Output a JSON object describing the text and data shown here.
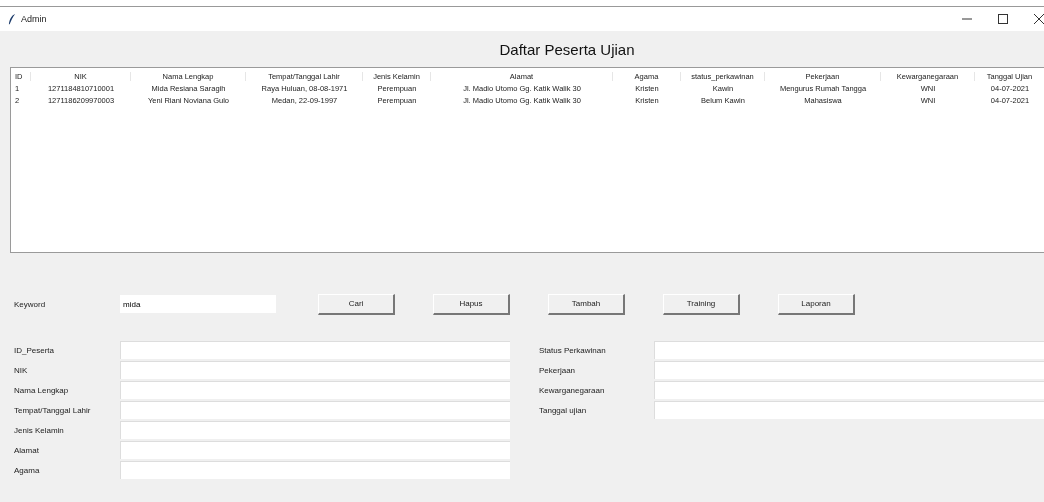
{
  "window": {
    "title": "Admin"
  },
  "heading": "Daftar Peserta Ujian",
  "table": {
    "columns": [
      "ID",
      "NIK",
      "Nama Lengkap",
      "Tempat/Tanggal Lahir",
      "Jenis Kelamin",
      "Alamat",
      "Agama",
      "status_perkawinan",
      "Pekerjaan",
      "Kewarganegaraan",
      "Tanggal Ujian"
    ],
    "rows": [
      [
        "1",
        "1271184810710001",
        "Mida Resiana Saragih",
        "Raya Huluan, 08-08-1971",
        "Perempuan",
        "Jl. Madio Utomo Gg. Katik Walik 30",
        "Kristen",
        "Kawin",
        "Mengurus Rumah Tangga",
        "WNI",
        "04-07-2021"
      ],
      [
        "2",
        "1271186209970003",
        "Yeni Riani Noviana Gulo",
        "Medan, 22-09-1997",
        "Perempuan",
        "Jl. Madio Utomo Gg. Katik Walik 30",
        "Kristen",
        "Belum Kawin",
        "Mahasiswa",
        "WNI",
        "04-07-2021"
      ]
    ]
  },
  "search": {
    "label": "Keyword",
    "value": "mida"
  },
  "buttons": [
    "Cari",
    "Hapus",
    "Tambah",
    "Training",
    "Laporan"
  ],
  "form_left": [
    "ID_Peserta",
    "NIK",
    "Nama Lengkap",
    "Tempat/Tanggal Lahir",
    "Jenis Kelamin",
    "Alamat",
    "Agama"
  ],
  "form_right": [
    "Status Perkawinan",
    "Pekerjaan",
    "Kewarganegaraan",
    "Tanggal ujian"
  ]
}
